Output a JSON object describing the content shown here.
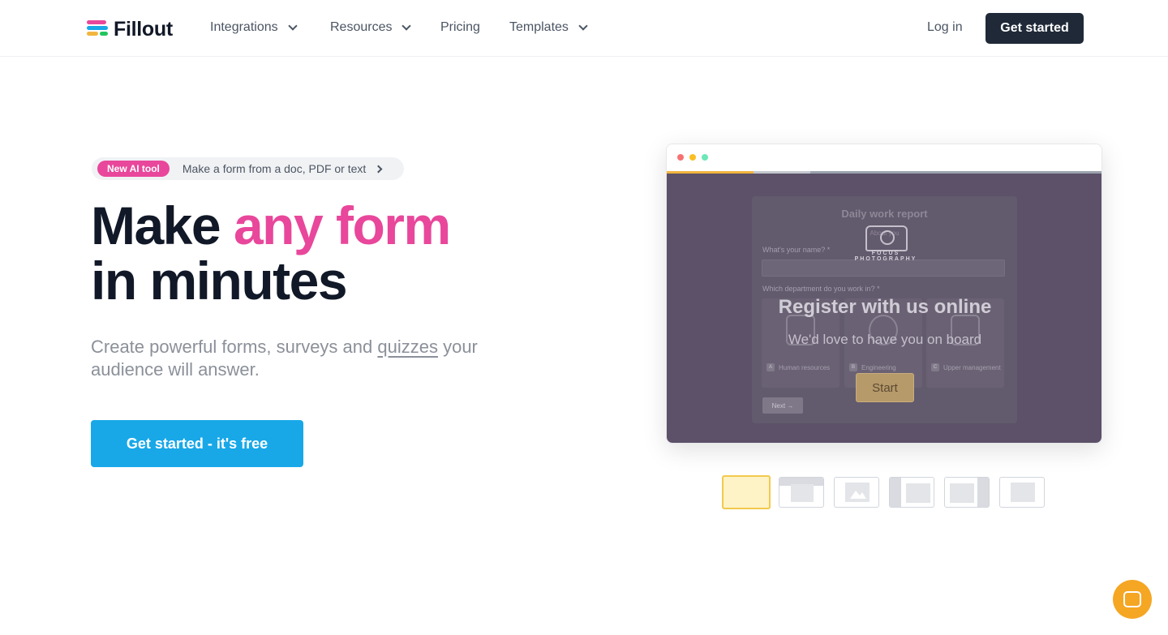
{
  "brand": {
    "name": "Fillout",
    "logo_colors": [
      "#e8479b",
      "#18a8e8",
      "#f2b53e",
      "#22c55e"
    ]
  },
  "nav": {
    "items": [
      {
        "label": "Integrations",
        "has_dropdown": true
      },
      {
        "label": "Resources",
        "has_dropdown": true
      },
      {
        "label": "Pricing",
        "has_dropdown": false
      },
      {
        "label": "Templates",
        "has_dropdown": true
      }
    ],
    "login": "Log in",
    "cta": "Get started"
  },
  "announcement": {
    "badge": "New AI tool",
    "text": "Make a form from a doc, PDF or text"
  },
  "hero": {
    "headline_1": "Make ",
    "headline_accent": "any form",
    "headline_2": "in minutes",
    "sub_1": "Create powerful forms, surveys and ",
    "sub_link": "quizzes",
    "sub_2": " your audience will answer.",
    "cta": "Get started - it's free"
  },
  "preview": {
    "form_title": "Daily work report",
    "form_section": "About you",
    "q1": "What's your name? *",
    "q2": "Which department do you work in? *",
    "options": [
      {
        "key": "A",
        "label": "Human resources"
      },
      {
        "key": "B",
        "label": "Engineering"
      },
      {
        "key": "C",
        "label": "Upper management"
      }
    ],
    "next": "Next →",
    "brand_mark": "FOCUS PHOTOGRAPHY",
    "overlay_title": "Register with us online",
    "overlay_sub": "We'd love to have you on board",
    "overlay_button": "Start",
    "colors": {
      "accent": "#f2b53e",
      "background": "#5c5168"
    }
  },
  "layout_options": [
    "standard",
    "cover",
    "image",
    "left-sidebar",
    "right-sidebar",
    "minimal"
  ],
  "colors": {
    "pink": "#e8479b",
    "blue": "#18a8e8",
    "dark": "#1f2937"
  }
}
